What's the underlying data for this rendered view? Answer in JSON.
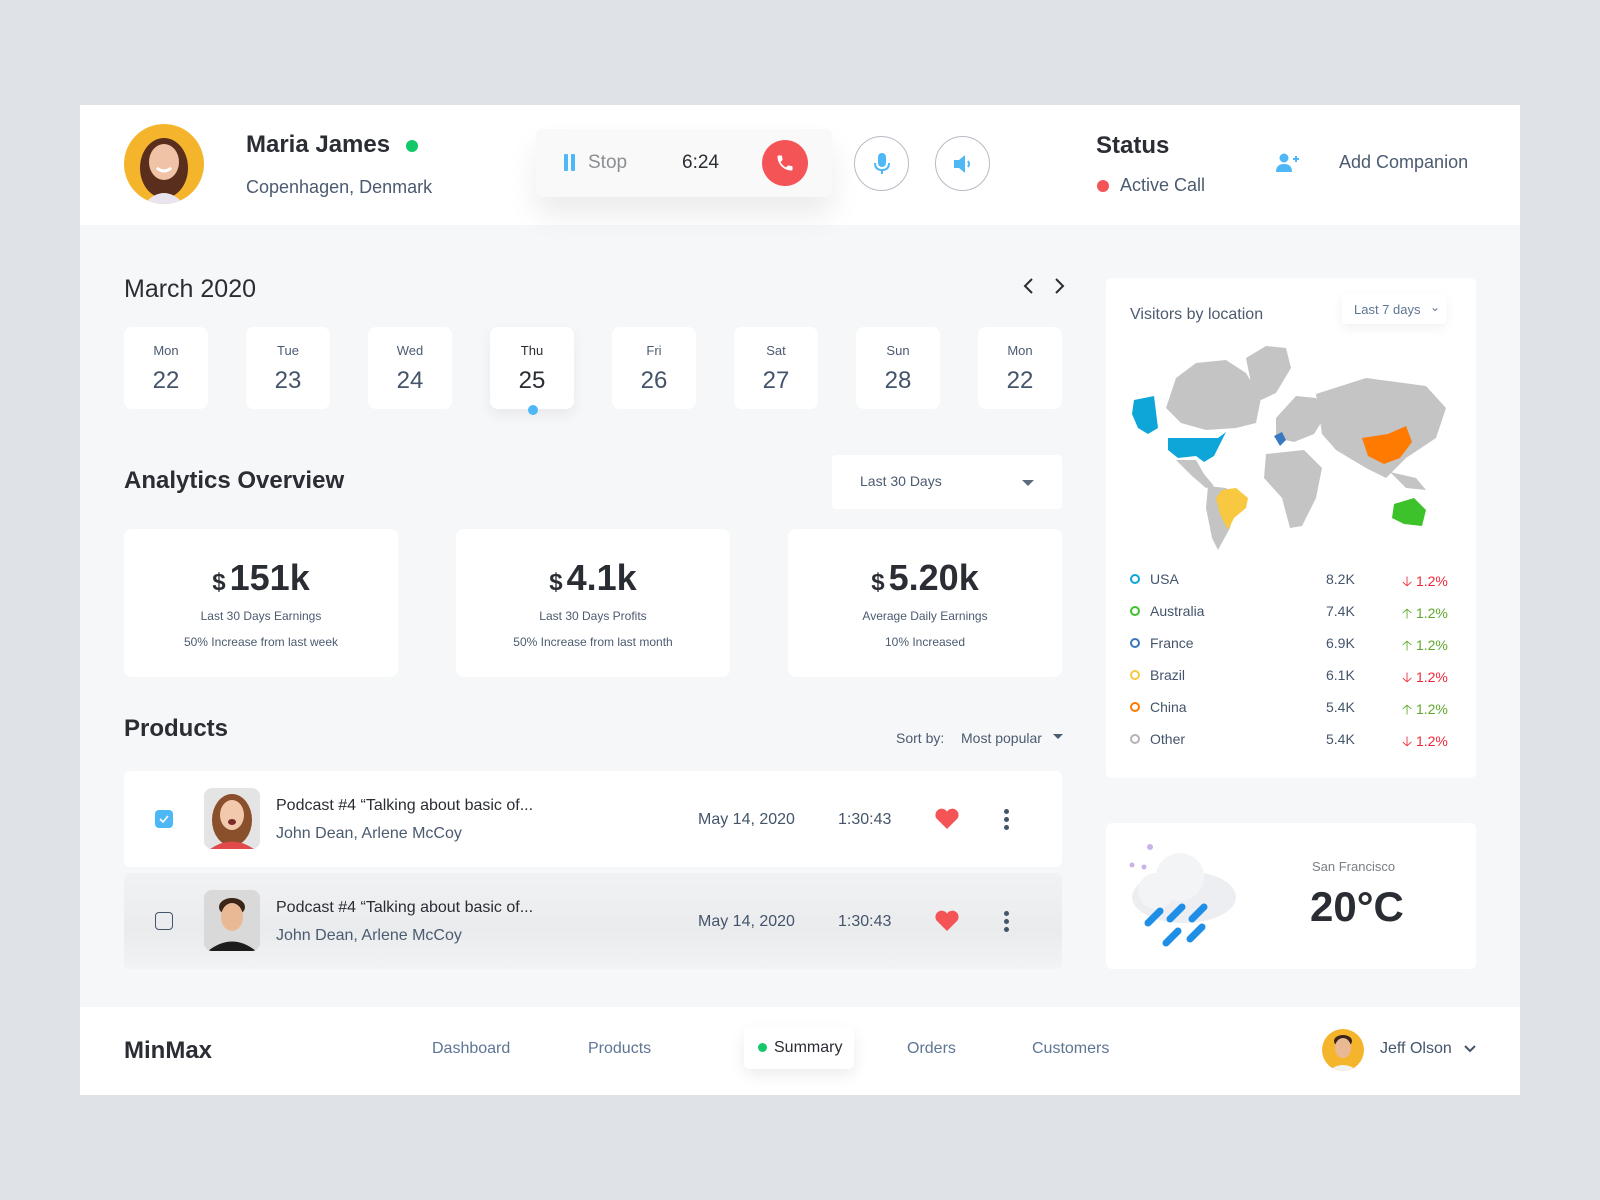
{
  "header": {
    "user_name": "Maria James",
    "user_location": "Copenhagen, Denmark",
    "call": {
      "stop_label": "Stop",
      "timer": "6:24"
    },
    "status_title": "Status",
    "status_text": "Active Call",
    "add_companion_label": "Add Companion"
  },
  "calendar": {
    "month": "March 2020",
    "days": [
      {
        "name": "Mon",
        "num": "22"
      },
      {
        "name": "Tue",
        "num": "23"
      },
      {
        "name": "Wed",
        "num": "24"
      },
      {
        "name": "Thu",
        "num": "25"
      },
      {
        "name": "Fri",
        "num": "26"
      },
      {
        "name": "Sat",
        "num": "27"
      },
      {
        "name": "Sun",
        "num": "28"
      },
      {
        "name": "Mon",
        "num": "22"
      }
    ],
    "selected_index": 3
  },
  "analytics": {
    "title": "Analytics Overview",
    "range": "Last 30 Days",
    "cards": [
      {
        "currency": "$",
        "value": "151k",
        "label": "Last 30 Days Earnings",
        "sub": "50% Increase from last week"
      },
      {
        "currency": "$",
        "value": "4.1k",
        "label": "Last 30 Days Profits",
        "sub": "50% Increase from last month"
      },
      {
        "currency": "$",
        "value": "5.20k",
        "label": "Average Daily Earnings",
        "sub": "10% Increased"
      }
    ]
  },
  "products": {
    "title": "Products",
    "sort_label": "Sort by:",
    "sort_value": "Most popular",
    "rows": [
      {
        "title": "Podcast #4 “Talking about basic of...",
        "authors": "John Dean, Arlene McCoy",
        "date": "May 14, 2020",
        "duration": "1:30:43",
        "checked": true,
        "liked": true
      },
      {
        "title": "Podcast #4 “Talking about basic of...",
        "authors": "John Dean, Arlene McCoy",
        "date": "May 14, 2020",
        "duration": "1:30:43",
        "checked": false,
        "liked": true
      }
    ]
  },
  "visitors": {
    "title": "Visitors by location",
    "range": "Last 7 days",
    "rows": [
      {
        "country": "USA",
        "count": "8.2K",
        "delta": "1.2%",
        "trend": "down",
        "color": "#0ea5d9"
      },
      {
        "country": "Australia",
        "count": "7.4K",
        "delta": "1.2%",
        "trend": "up",
        "color": "#3dc22c"
      },
      {
        "country": "France",
        "count": "6.9K",
        "delta": "1.2%",
        "trend": "up",
        "color": "#3a78c2"
      },
      {
        "country": "Brazil",
        "count": "6.1K",
        "delta": "1.2%",
        "trend": "down",
        "color": "#f8c841"
      },
      {
        "country": "China",
        "count": "5.4K",
        "delta": "1.2%",
        "trend": "up",
        "color": "#ff7a00"
      },
      {
        "country": "Other",
        "count": "5.4K",
        "delta": "1.2%",
        "trend": "down",
        "color": "#b4b4b4"
      }
    ]
  },
  "weather": {
    "city": "San Francisco",
    "temperature": "20°C"
  },
  "footer": {
    "brand": "MinMax",
    "nav": [
      "Dashboard",
      "Products",
      "Summary",
      "Orders",
      "Customers"
    ],
    "active_nav": "Summary",
    "user_name": "Jeff Olson"
  },
  "colors": {
    "accent_blue": "#4db8f5",
    "danger_red": "#f55457",
    "online_green": "#14c86a"
  }
}
